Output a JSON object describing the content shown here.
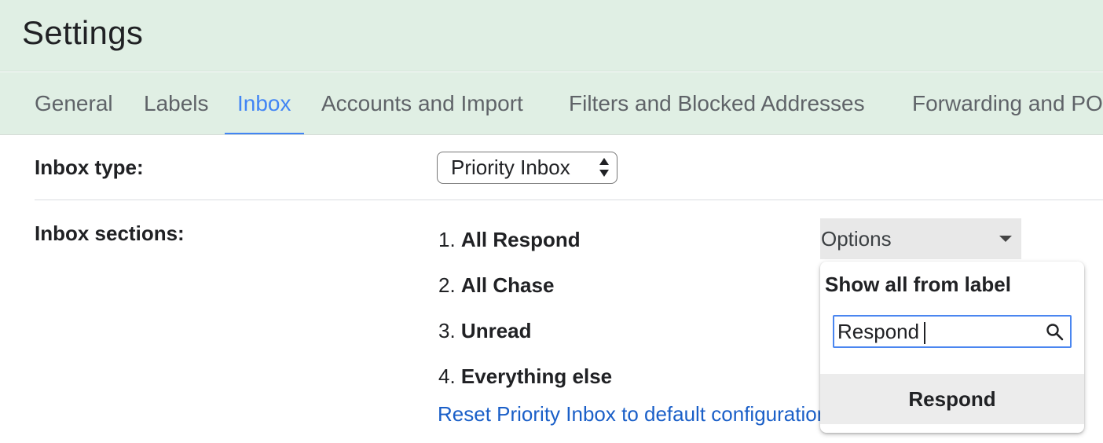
{
  "header": {
    "title": "Settings"
  },
  "tabs": [
    {
      "label": "General",
      "active": false
    },
    {
      "label": "Labels",
      "active": false
    },
    {
      "label": "Inbox",
      "active": true
    },
    {
      "label": "Accounts and Import",
      "active": false
    },
    {
      "label": "Filters and Blocked Addresses",
      "active": false
    },
    {
      "label": "Forwarding and POP/IMAP",
      "active": false
    }
  ],
  "inbox_type": {
    "label": "Inbox type:",
    "selected": "Priority Inbox"
  },
  "inbox_sections": {
    "label": "Inbox sections:",
    "items": [
      {
        "num": "1.",
        "name": "All Respond"
      },
      {
        "num": "2.",
        "name": "All Chase"
      },
      {
        "num": "3.",
        "name": "Unread"
      },
      {
        "num": "4.",
        "name": "Everything else"
      }
    ],
    "reset_link": "Reset Priority Inbox to default configuration"
  },
  "options": {
    "label": "Options",
    "popup": {
      "heading": "Show all from label",
      "search_value": "Respond",
      "result": "Respond"
    }
  },
  "colors": {
    "header_bg": "#e0efe4",
    "accent": "#4285f4",
    "link": "#1a5fc8"
  }
}
